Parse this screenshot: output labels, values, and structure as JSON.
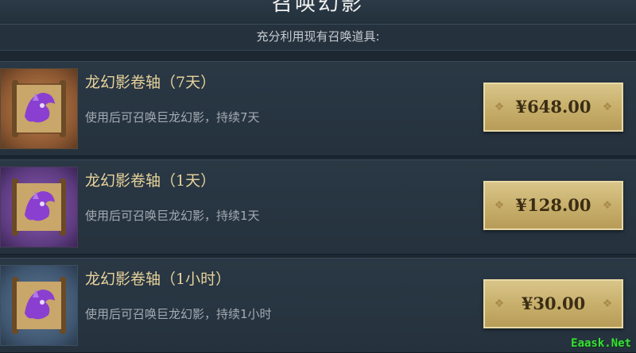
{
  "header": {
    "title": "召唤幻影",
    "subtitle": "充分利用现有召唤道具:"
  },
  "items": [
    {
      "name": "龙幻影卷轴（7天）",
      "desc": "使用后可召唤巨龙幻影，持续7天",
      "price": "¥648.00",
      "frame": "orange"
    },
    {
      "name": "龙幻影卷轴（1天）",
      "desc": "使用后可召唤巨龙幻影，持续1天",
      "price": "¥128.00",
      "frame": "purple"
    },
    {
      "name": "龙幻影卷轴（1小时）",
      "desc": "使用后可召唤巨龙幻影，持续1小时",
      "price": "¥30.00",
      "frame": "blue"
    }
  ],
  "watermark": "Eaask.Net",
  "colors": {
    "background": "#1c2732",
    "gold_text": "#e8d39a",
    "button_gold": "#c8b06c",
    "watermark_green": "#39e039"
  },
  "icons": {
    "item_icon": "dragon-scroll-icon"
  }
}
